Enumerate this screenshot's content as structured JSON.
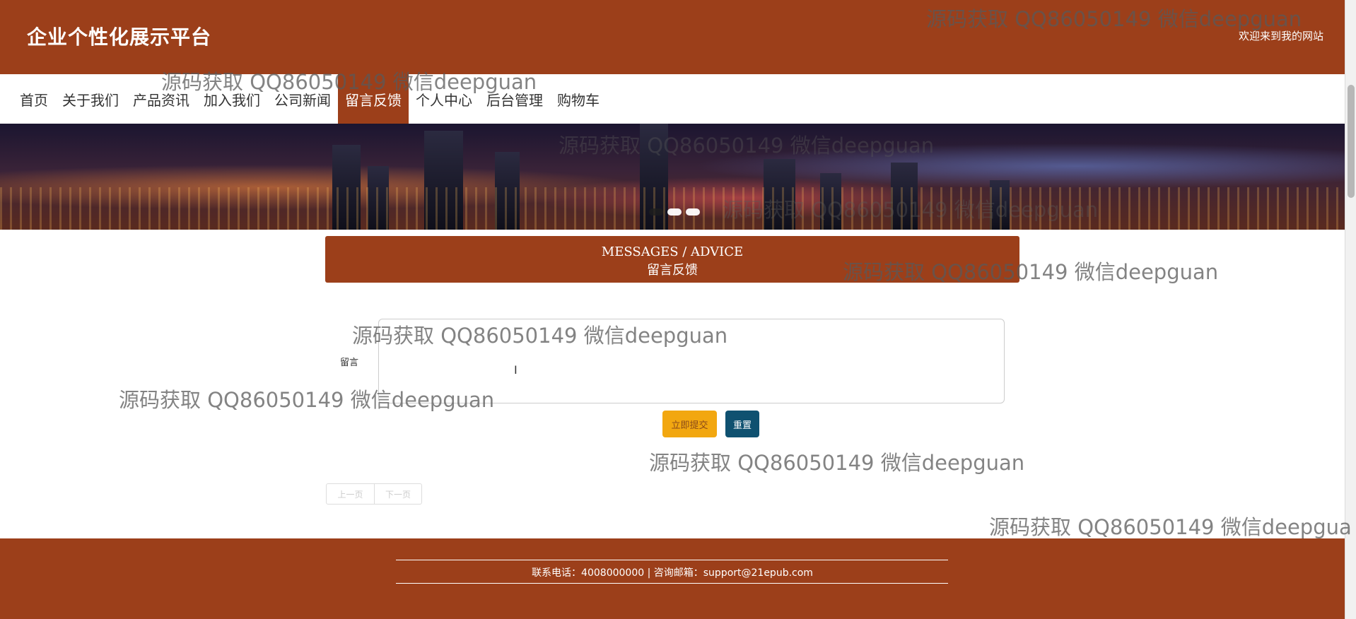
{
  "header": {
    "site_title": "企业个性化展示平台",
    "welcome": "欢迎来到我的网站"
  },
  "nav": {
    "items": [
      {
        "label": "首页"
      },
      {
        "label": "关于我们"
      },
      {
        "label": "产品资讯"
      },
      {
        "label": "加入我们"
      },
      {
        "label": "公司新闻"
      },
      {
        "label": "留言反馈"
      },
      {
        "label": "个人中心"
      },
      {
        "label": "后台管理"
      },
      {
        "label": "购物车"
      }
    ],
    "active": "留言反馈"
  },
  "banner": {
    "slide_count": 3,
    "active_slide": 2
  },
  "section": {
    "title_en": "MESSAGES / ADVICE",
    "title_cn": "留言反馈"
  },
  "form": {
    "message_label": "留言",
    "message_value": "",
    "submit_label": "立即提交",
    "reset_label": "重置"
  },
  "pager": {
    "prev_label": "上一页",
    "next_label": "下一页"
  },
  "footer": {
    "contact": "联系电话：4008000000 | 咨询邮箱：support@21epub.com"
  },
  "watermark": {
    "text": "源码获取 QQ86050149 微信deepguan",
    "text_clipped": "源码获取 QQ86050149 微信deepgua"
  },
  "colors": {
    "brand": "#9c3f1a",
    "submit": "#f2a710",
    "reset": "#0f5170"
  }
}
